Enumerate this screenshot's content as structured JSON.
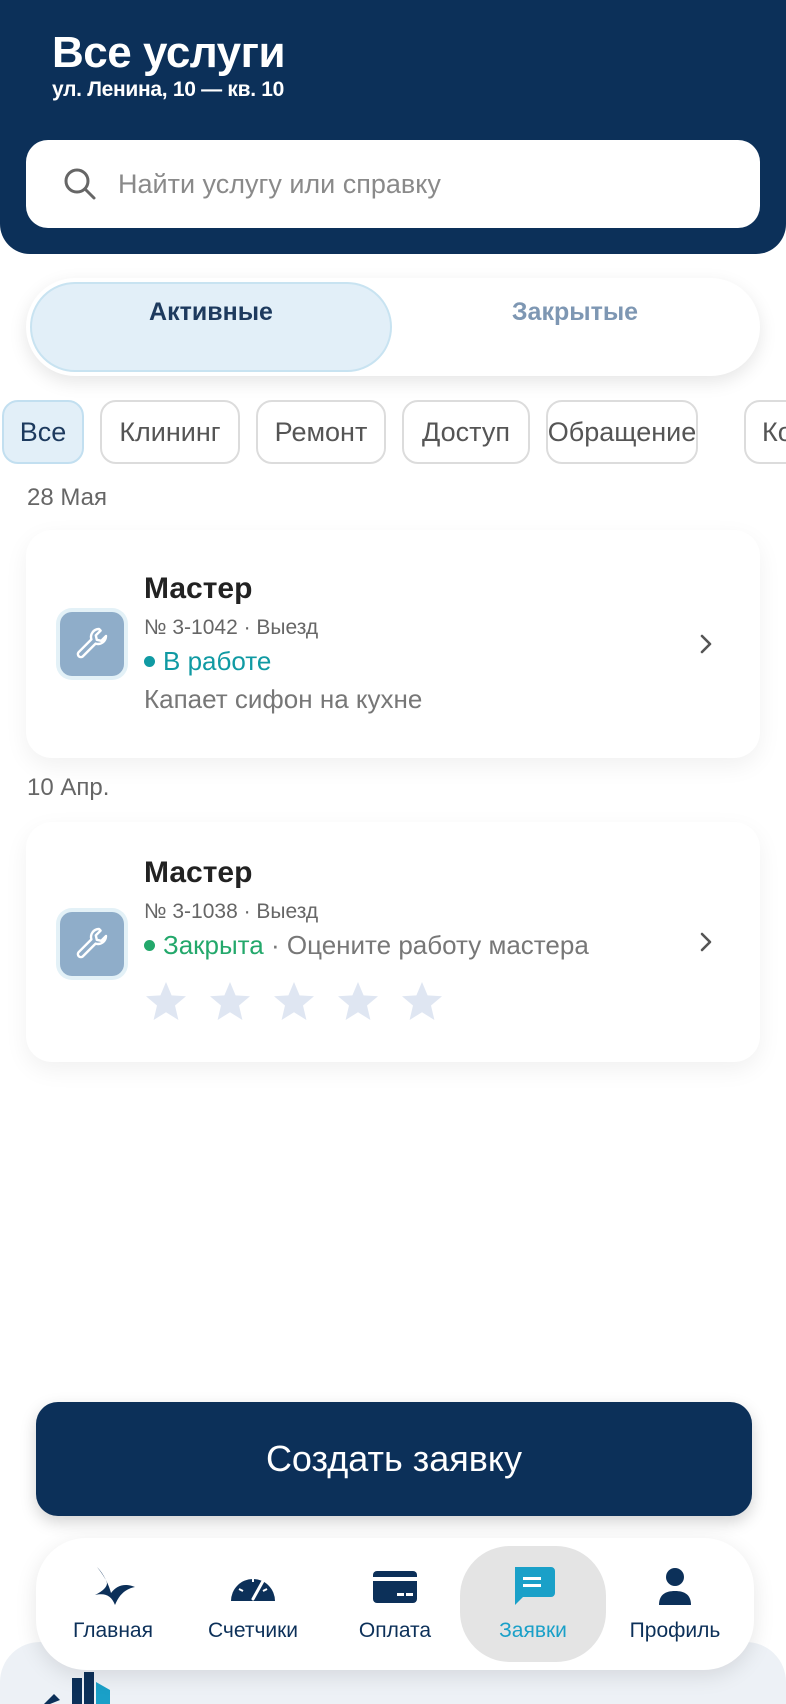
{
  "header": {
    "title": "Все услуги",
    "address": "ул. Ленина, 10 — кв. 10"
  },
  "search": {
    "placeholder": "Найти услугу или справку",
    "value": ""
  },
  "segments": [
    {
      "label": "Активные",
      "selected": true
    },
    {
      "label": "Закрытые",
      "selected": false
    }
  ],
  "filters": [
    {
      "label": "Все",
      "selected": true
    },
    {
      "label": "Клининг",
      "selected": false
    },
    {
      "label": "Ремонт",
      "selected": false
    },
    {
      "label": "Доступ",
      "selected": false
    },
    {
      "label": "Обращение",
      "selected": false
    },
    {
      "label": "Ко",
      "selected": false
    }
  ],
  "requests": [
    {
      "date": "28 Мая",
      "title": "Мастер",
      "meta": "№ 3-1042 · Выезд",
      "status": "В работе",
      "status_color": "#109aa3",
      "description": "Капает сифон на кухне",
      "icon": "wrench-icon"
    },
    {
      "date": "10 Апр.",
      "title": "Мастер",
      "meta": "№ 3-1038 · Выезд",
      "status": "Закрыта",
      "status_color": "#23a86b",
      "status_note": " · Оцените работу мастера",
      "rating": 0,
      "rating_max": 5,
      "icon": "wrench-icon"
    }
  ],
  "create_button": "Создать заявку",
  "nav": [
    {
      "label": "Главная",
      "icon": "bird-home-icon",
      "active": false
    },
    {
      "label": "Счетчики",
      "icon": "gauge-icon",
      "active": false
    },
    {
      "label": "Оплата",
      "icon": "card-icon",
      "active": false
    },
    {
      "label": "Заявки",
      "icon": "chat-icon",
      "active": true
    },
    {
      "label": "Профиль",
      "icon": "user-icon",
      "active": false
    }
  ],
  "colors": {
    "primary": "#0c3059",
    "accent": "#1aa0c8",
    "star_empty": "#dfe6f2"
  }
}
